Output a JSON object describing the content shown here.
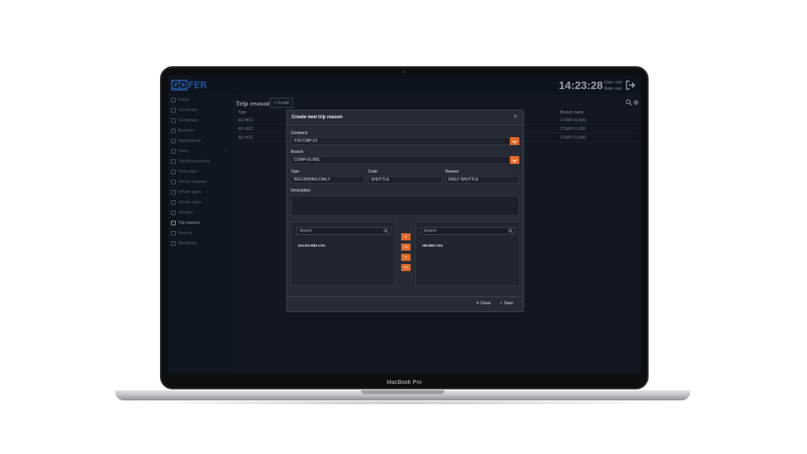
{
  "device": {
    "label": "MacBook Pro"
  },
  "app": {
    "logo": {
      "boxed": "GO",
      "rest": "FER"
    },
    "clock": "14:23:28",
    "user": {
      "user_line": "User: root",
      "role_line": "Role: root"
    }
  },
  "sidebar": {
    "items": [
      {
        "label": "Points"
      },
      {
        "label": "Currencies"
      },
      {
        "label": "Companies"
      },
      {
        "label": "Branches"
      },
      {
        "label": "Departments"
      },
      {
        "label": "Users"
      },
      {
        "label": "Tracking accounts"
      },
      {
        "label": "Price plans"
      },
      {
        "label": "Vehicle requests"
      },
      {
        "label": "Vehicle types"
      },
      {
        "label": "Vehicle class"
      },
      {
        "label": "Vehicles"
      },
      {
        "label": "Trip reasons"
      },
      {
        "label": "Reports"
      },
      {
        "label": "Monitoring"
      }
    ],
    "active": "Trip reasons"
  },
  "main": {
    "title": "Trip reasons",
    "create_label": "+ Create",
    "table": {
      "headers": {
        "type": "Type",
        "branch": "Branch name"
      },
      "rows": [
        {
          "type": "AD-HOC",
          "branch": "COMP-01-B81"
        },
        {
          "type": "AD-HOC",
          "branch": "COMP-01-B81"
        },
        {
          "type": "AD-HOC",
          "branch": "COMP-01-B81"
        }
      ]
    }
  },
  "modal": {
    "title": "Create new trip reason",
    "company": {
      "label": "Company",
      "value": "YSV-CMP-01"
    },
    "branch": {
      "label": "Branch",
      "value": "COMP-01-B81"
    },
    "type": {
      "label": "Type",
      "value": "RECURRING-DAILY"
    },
    "code": {
      "label": "Code",
      "value": "SHUTTLE"
    },
    "reason": {
      "label": "Reason",
      "value": "DAILY SHUTTLE"
    },
    "description": {
      "label": "Description",
      "value": ""
    },
    "left_panel": {
      "search_placeholder": "Search",
      "items": [
        "SALES-B81-C01"
      ]
    },
    "right_panel": {
      "search_placeholder": "Search",
      "items": [
        "HR-B81-C01"
      ]
    },
    "transfer_buttons": [
      ">",
      ">>",
      "<",
      "<<"
    ],
    "close_label": "Close",
    "save_label": "Save"
  }
}
